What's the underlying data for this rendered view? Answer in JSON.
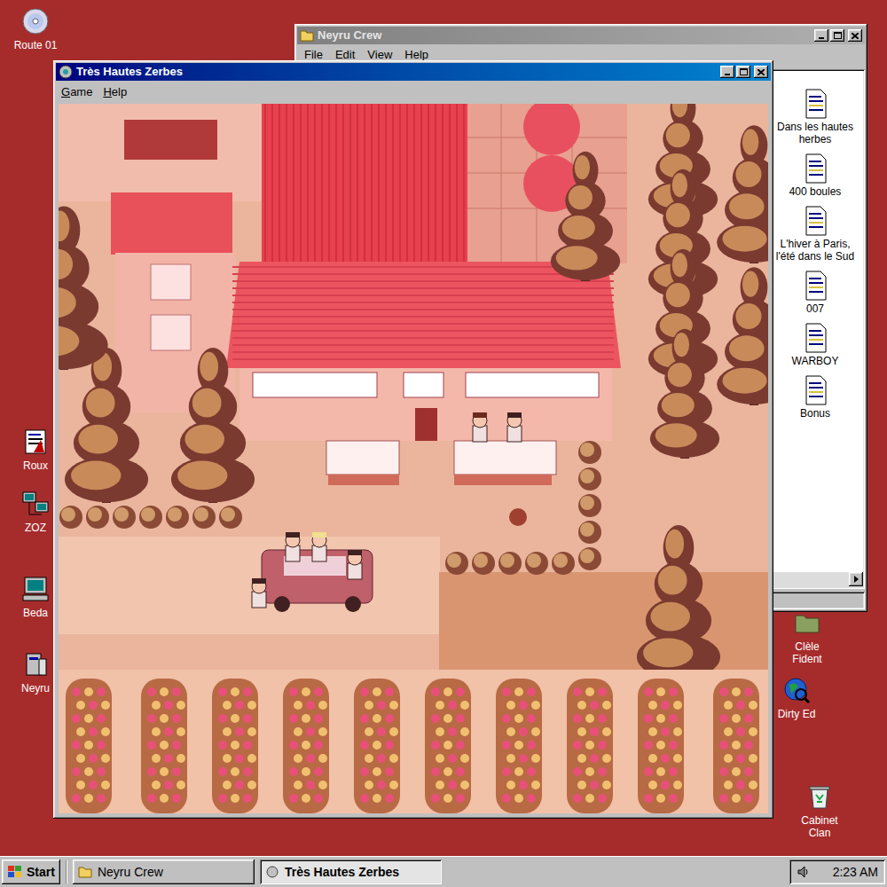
{
  "desktop_icons": [
    {
      "label": "Route 01",
      "kind": "cd"
    },
    {
      "label": "Roux",
      "kind": "document"
    },
    {
      "label": "ZOZ",
      "kind": "network"
    },
    {
      "label": "Beda",
      "kind": "computer"
    },
    {
      "label": "Neyru",
      "kind": "program"
    },
    {
      "label": "Clèle Fident",
      "kind": "folder"
    },
    {
      "label": "Dirty Ed",
      "kind": "globe"
    },
    {
      "label": "Cabinet Clan",
      "kind": "recycle"
    }
  ],
  "explorer": {
    "title": "Neyru Crew",
    "selected": false,
    "menu": [
      "File",
      "Edit",
      "View",
      "Help"
    ],
    "files": [
      "Dans les hautes herbes",
      "400 boules",
      "L'hiver à Paris, l'été dans le Sud",
      "007",
      "WARBOY",
      "Bonus"
    ]
  },
  "game": {
    "title": "Très Hautes Zerbes",
    "selected": true,
    "menu": [
      "Game",
      "Help"
    ]
  },
  "taskbar": {
    "start": "Start",
    "buttons": [
      {
        "label": "Neyru Crew",
        "selected": false
      },
      {
        "label": "Très Hautes Zerbes",
        "selected": true
      }
    ],
    "clock": "2:23 AM"
  }
}
